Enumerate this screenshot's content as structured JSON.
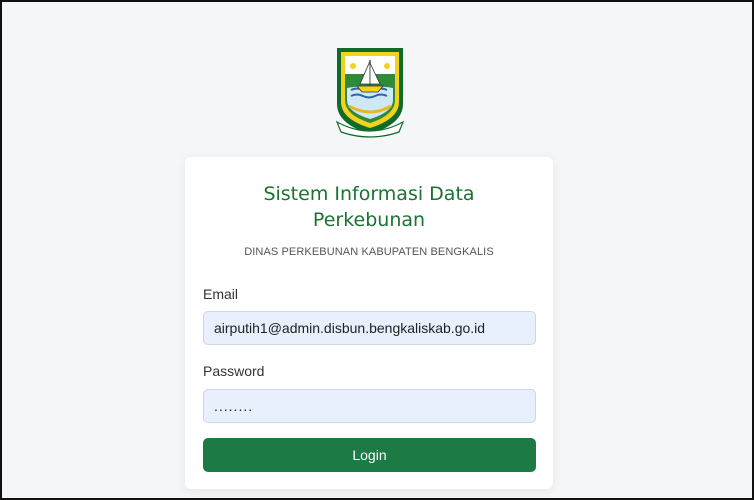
{
  "app": {
    "title": "Sistem Informasi Data Perkebunan",
    "subtitle": "DINAS PERKEBUNAN KABUPATEN BENGKALIS",
    "logo_icon": "coat-of-arms-emblem"
  },
  "form": {
    "email_label": "Email",
    "email_value": "airputih1@admin.disbun.bengkaliskab.go.id",
    "password_label": "Password",
    "password_value": "........",
    "login_label": "Login"
  },
  "colors": {
    "primary_green": "#1c7a45",
    "title_green": "#1a7331",
    "input_background": "#e8f0fe",
    "page_background": "#f5f6f8"
  }
}
